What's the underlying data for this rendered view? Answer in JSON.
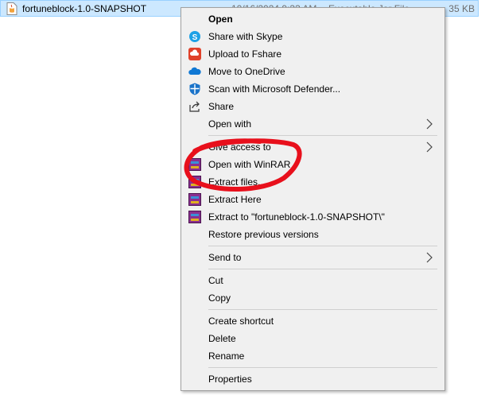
{
  "file": {
    "name": "fortuneblock-1.0-SNAPSHOT",
    "date": "10/16/2024 9:33 AM",
    "type": "Executable Jar File",
    "size": "35 KB"
  },
  "menu": {
    "open": "Open",
    "share_skype": "Share with Skype",
    "upload_fshare": "Upload to Fshare",
    "move_onedrive": "Move to OneDrive",
    "scan_defender": "Scan with Microsoft Defender...",
    "share": "Share",
    "open_with": "Open with",
    "give_access": "Give access to",
    "open_winrar": "Open with WinRAR",
    "extract_files": "Extract files...",
    "extract_here": "Extract Here",
    "extract_to": "Extract to \"fortuneblock-1.0-SNAPSHOT\\\"",
    "restore": "Restore previous versions",
    "send_to": "Send to",
    "cut": "Cut",
    "copy": "Copy",
    "create_shortcut": "Create shortcut",
    "delete": "Delete",
    "rename": "Rename",
    "properties": "Properties"
  },
  "colors": {
    "selection": "#cce8ff",
    "menu_bg": "#f0f0f0",
    "annotation": "#e8101c"
  }
}
